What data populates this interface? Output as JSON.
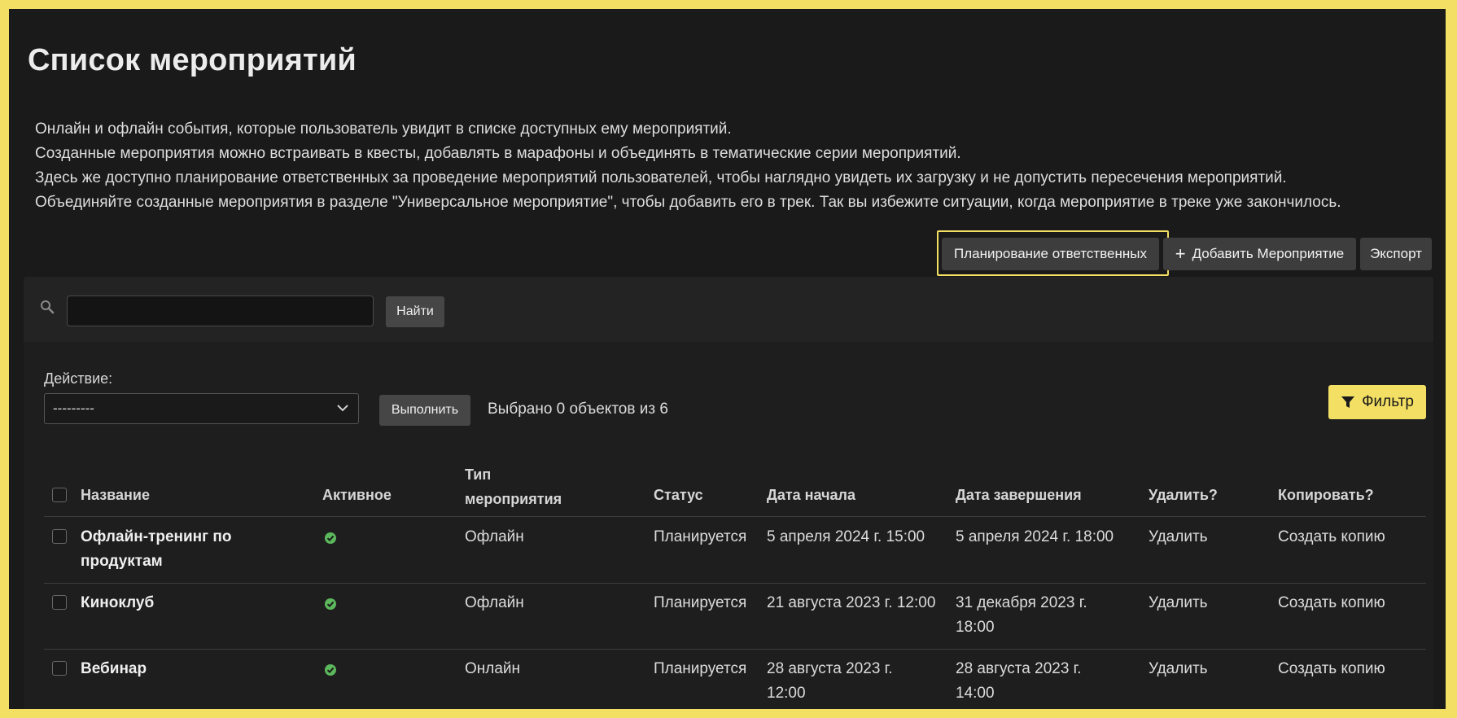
{
  "page": {
    "title": "Список мероприятий",
    "description": [
      "Онлайн и офлайн события, которые пользователь увидит в списке доступных ему мероприятий.",
      "Созданные мероприятия можно встраивать в квесты, добавлять в марафоны и объединять в тематические серии мероприятий.",
      "Здесь же доступно планирование ответственных за проведение мероприятий пользователей, чтобы наглядно увидеть их загрузку и не допустить пересечения мероприятий.",
      "Объединяйте созданные мероприятия в разделе \"Универсальное мероприятие\", чтобы добавить его в трек. Так вы избежите ситуации, когда мероприятие в треке уже закончилось."
    ]
  },
  "toolbar": {
    "planning_label": "Планирование ответственных",
    "add_label": "Добавить Мероприятие",
    "add_icon": "+",
    "export_label": "Экспорт"
  },
  "search": {
    "value": "",
    "placeholder": "",
    "button_label": "Найти"
  },
  "actions": {
    "label": "Действие:",
    "selected": "---------",
    "execute_label": "Выполнить",
    "selected_count": "Выбрано 0 объектов из 6",
    "filter_label": "Фильтр"
  },
  "table": {
    "columns": [
      "Название",
      "Активное",
      "Тип мероприятия",
      "Статус",
      "Дата начала",
      "Дата завершения",
      "Удалить?",
      "Копировать?"
    ],
    "column_type_lines": [
      "Тип",
      "мероприятия"
    ],
    "rows": [
      {
        "name": [
          "Офлайн-тренинг по",
          "продуктам"
        ],
        "active": true,
        "type": "Офлайн",
        "status": "Планируется",
        "start": [
          "5 апреля 2024 г. 15:00"
        ],
        "end": [
          "5 апреля 2024 г. 18:00"
        ],
        "delete": "Удалить",
        "copy": "Создать копию"
      },
      {
        "name": [
          "Киноклуб"
        ],
        "active": true,
        "type": "Офлайн",
        "status": "Планируется",
        "start": [
          "21 августа 2023 г. 12:00"
        ],
        "end": [
          "31 декабря 2023 г.",
          "18:00"
        ],
        "delete": "Удалить",
        "copy": "Создать копию"
      },
      {
        "name": [
          "Вебинар"
        ],
        "active": true,
        "type": "Онлайн",
        "status": "Планируется",
        "start": [
          "28 августа 2023 г.",
          "12:00"
        ],
        "end": [
          "28 августа 2023 г.",
          "14:00"
        ],
        "delete": "Удалить",
        "copy": "Создать копию"
      }
    ]
  },
  "colors": {
    "accent": "#f2df63",
    "active_check": "#5cb85c",
    "background": "#1a1a1a"
  }
}
